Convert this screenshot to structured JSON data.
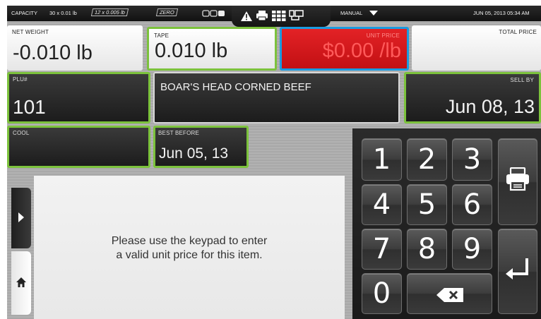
{
  "status_bar": {
    "capacity_label": "CAPACITY",
    "capacity_range_1": "30 x 0.01 lb",
    "capacity_range_2": "12 x 0.005 lb",
    "zero_label": "ZERO",
    "mode_label": "MANUAL",
    "datetime": "JUN 05, 2013 05:34 AM"
  },
  "fields": {
    "net_weight": {
      "label": "NET WEIGHT",
      "value": "-0.010 lb"
    },
    "tare": {
      "label": "TAPE",
      "value": "0.010 lb"
    },
    "unit_price": {
      "label": "UNIT PRICE",
      "value": "$0.00 /lb"
    },
    "total_price": {
      "label": "TOTAL PRICE",
      "value": ""
    },
    "plu": {
      "label": "PLU#",
      "value": "101"
    },
    "description": {
      "value": "BOAR'S HEAD CORNED BEEF"
    },
    "sell_by": {
      "label": "SELL BY",
      "value": "Jun 08, 13"
    },
    "cool": {
      "label": "COOL",
      "value": ""
    },
    "best_before": {
      "label": "BEST BEFORE",
      "value": "Jun 05, 13"
    }
  },
  "message": {
    "line1": "Please use the keypad to enter",
    "line2": "a valid unit price for this item."
  },
  "keypad": {
    "keys": [
      "1",
      "2",
      "3",
      "4",
      "5",
      "6",
      "7",
      "8",
      "9",
      "0"
    ]
  },
  "colors": {
    "accent_green": "#7cc23c",
    "unit_price_red": "#d8181c",
    "unit_price_border": "#1a9be0",
    "unit_price_text": "#ff5555"
  },
  "icons": [
    "warning-icon",
    "printer-status-icon",
    "grid-icon",
    "network-icon",
    "dropdown-arrow-icon",
    "printer-icon",
    "enter-icon",
    "backspace-icon",
    "home-icon",
    "expand-arrow-icon"
  ]
}
